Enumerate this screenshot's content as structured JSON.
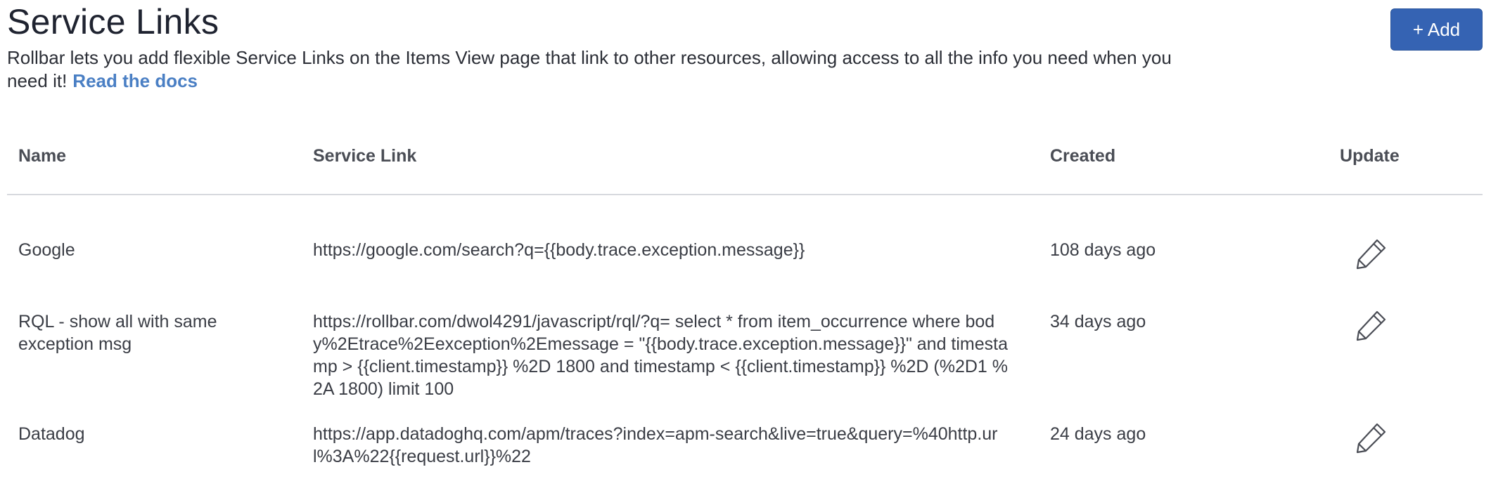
{
  "header": {
    "title": "Service Links",
    "description": "Rollbar lets you add flexible Service Links on the Items View page that link to other resources, allowing access to all the info you need when you need it!",
    "docs_link": "Read the docs",
    "add_button": "+ Add"
  },
  "table": {
    "columns": {
      "name": "Name",
      "link": "Service Link",
      "created": "Created",
      "update": "Update"
    },
    "rows": [
      {
        "name": "Google",
        "link": "https://google.com/search?q={{body.trace.exception.message}}",
        "created": "108 days ago",
        "update_icon": "pencil-icon"
      },
      {
        "name": "RQL - show all with same exception msg",
        "link": "https://rollbar.com/dwol4291/javascript/rql/?q= select * from item_occurrence where body%2Etrace%2Eexception%2Emessage = \"{{body.trace.exception.message}}\" and timestamp > {{client.timestamp}} %2D 1800 and timestamp < {{client.timestamp}} %2D (%2D1 %2A 1800) limit 100",
        "created": "34 days ago",
        "update_icon": "pencil-icon"
      },
      {
        "name": "Datadog",
        "link": "https://app.datadoghq.com/apm/traces?index=apm-search&live=true&query=%40http.url%3A%22{{request.url}}%22",
        "created": "24 days ago",
        "update_icon": "pencil-icon"
      }
    ]
  },
  "colors": {
    "accent": "#3563b3",
    "link": "#4a7fc4",
    "divider": "#d7d9de"
  }
}
